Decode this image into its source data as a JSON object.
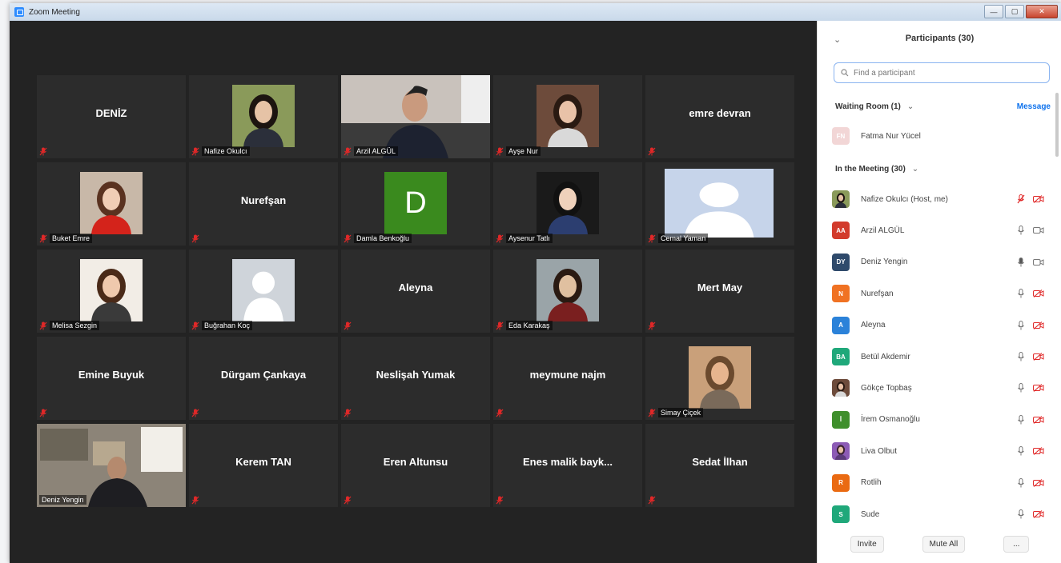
{
  "window": {
    "title": "Zoom Meeting",
    "controls": [
      "—",
      "▢",
      "✕"
    ]
  },
  "tiles": [
    {
      "name": "DENİZ",
      "type": "name"
    },
    {
      "name": "Nafize Okulcı",
      "type": "photo",
      "photo": "woman-dark-hair"
    },
    {
      "name": "Arzil ALGÜL",
      "type": "video",
      "photo": "man-office"
    },
    {
      "name": "Ayşe Nur",
      "type": "photo",
      "photo": "woman-portrait"
    },
    {
      "name": "emre devran",
      "type": "name"
    },
    {
      "name": "Buket Emre",
      "type": "photo",
      "photo": "woman-red"
    },
    {
      "name": "Nurefşan",
      "type": "name"
    },
    {
      "name": "Damla Benkoğlu",
      "type": "letter",
      "letter": "D",
      "color": "#3a8a1e"
    },
    {
      "name": "Aysenur Tatlı",
      "type": "photo",
      "photo": "woman-bangs"
    },
    {
      "name": "Cemal Yaman",
      "type": "default-avatar",
      "variant": "blue"
    },
    {
      "name": "Melisa Sezgin",
      "type": "photo",
      "photo": "woman-long-hair"
    },
    {
      "name": "Buğrahan Koç",
      "type": "default-avatar",
      "variant": "grey"
    },
    {
      "name": "Aleyna",
      "type": "name"
    },
    {
      "name": "Eda Karakaş",
      "type": "photo",
      "photo": "person-beach"
    },
    {
      "name": "Mert May",
      "type": "name"
    },
    {
      "name": "Emine Buyuk",
      "type": "name"
    },
    {
      "name": "Dürgam Çankaya",
      "type": "name"
    },
    {
      "name": "Neslişah Yumak",
      "type": "name"
    },
    {
      "name": "meymune najm",
      "type": "name"
    },
    {
      "name": "Simay Çiçek",
      "type": "photo",
      "photo": "woman-sunset"
    },
    {
      "name": "Deniz Yengin",
      "type": "video",
      "photo": "man-room",
      "active": true
    },
    {
      "name": "Kerem TAN",
      "type": "name"
    },
    {
      "name": "Eren Altunsu",
      "type": "name"
    },
    {
      "name": "Enes malik bayk...",
      "type": "name"
    },
    {
      "name": "Sedat İlhan",
      "type": "name"
    }
  ],
  "panel": {
    "title": "Participants (30)",
    "search_placeholder": "Find a participant",
    "waiting_label": "Waiting Room (1)",
    "message_label": "Message",
    "waiting_person": {
      "name": "Fatma Nur Yücel",
      "initials": "FN"
    },
    "in_meeting_label": "In the Meeting (30)",
    "participants": [
      {
        "name": "Nafize Okulcı (Host, me)",
        "avatar": "photo",
        "photo": "woman-dark-hair",
        "mic": "muted-red",
        "video": "off-red"
      },
      {
        "name": "Arzil ALGÜL",
        "avatar": "initials",
        "initials": "AA",
        "color": "#d23b2c",
        "mic": "on",
        "video": "on"
      },
      {
        "name": "Deniz Yengin",
        "avatar": "initials",
        "initials": "DY",
        "color": "#2f4a6b",
        "mic": "active",
        "video": "on"
      },
      {
        "name": "Nurefşan",
        "avatar": "initials",
        "initials": "N",
        "color": "#f07223",
        "mic": "on",
        "video": "off-red"
      },
      {
        "name": "Aleyna",
        "avatar": "initials",
        "initials": "A",
        "color": "#2b82d9",
        "mic": "on",
        "video": "off-red"
      },
      {
        "name": "Betül Akdemir",
        "avatar": "initials",
        "initials": "BA",
        "color": "#1fa87a",
        "mic": "on",
        "video": "off-red"
      },
      {
        "name": "Gökçe Topbaş",
        "avatar": "photo",
        "photo": "woman-portrait",
        "mic": "on",
        "video": "off-red"
      },
      {
        "name": "İrem Osmanoğlu",
        "avatar": "initials",
        "initials": "İ",
        "color": "#3f8f2c",
        "mic": "on",
        "video": "off-red"
      },
      {
        "name": "Liva Olbut",
        "avatar": "photo",
        "photo": "woman-purple",
        "mic": "on",
        "video": "off-red"
      },
      {
        "name": "Rotlih",
        "avatar": "initials",
        "initials": "R",
        "color": "#ea6a12",
        "mic": "on",
        "video": "off-red"
      },
      {
        "name": "Sude",
        "avatar": "initials",
        "initials": "S",
        "color": "#1fa87a",
        "mic": "on",
        "video": "off-red"
      }
    ],
    "footer": {
      "invite": "Invite",
      "mute_all": "Mute All",
      "more": "..."
    }
  }
}
